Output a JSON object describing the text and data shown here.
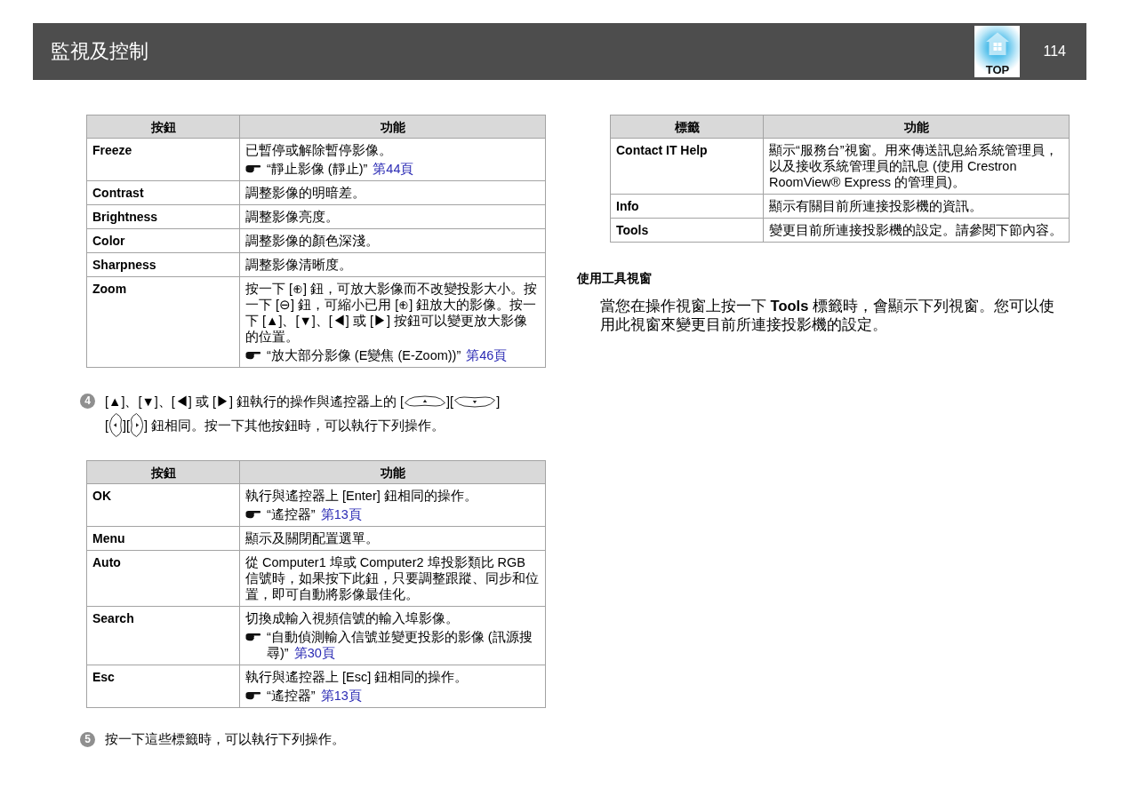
{
  "header": {
    "title": "監視及控制",
    "top_label": "TOP",
    "page_number": "114"
  },
  "left": {
    "table_1": {
      "columns": [
        "按鈕",
        "功能"
      ],
      "rows": [
        {
          "name": "Freeze",
          "description": "已暫停或解除暫停影像。",
          "reference": {
            "text": "“靜止影像 (靜止)”",
            "page": "第44頁"
          }
        },
        {
          "name": "Contrast",
          "description": "調整影像的明暗差。"
        },
        {
          "name": "Brightness",
          "description": "調整影像亮度。"
        },
        {
          "name": "Color",
          "description": "調整影像的顏色深淺。"
        },
        {
          "name": "Sharpness",
          "description": "調整影像清晰度。"
        },
        {
          "name": "Zoom",
          "description": "按一下 [⊕] 鈕，可放大影像而不改變投影大小。按一下 [⊖] 鈕，可縮小已用 [⊕] 鈕放大的影像。按一下 [▲]、[▼]、[◀] 或 [▶] 按鈕可以變更放大影像的位置。",
          "reference": {
            "text": "“放大部分影像 (E變焦 (E-Zoom))”",
            "page": "第46頁"
          }
        }
      ]
    },
    "step_4": {
      "number": "4",
      "lines": [
        [
          "[▲]、[▼]、[◀] 或 [▶] 鈕執行的操作與遙控器上的 [",
          "][",
          "]"
        ],
        [
          "[",
          "][",
          "] 鈕相同。按一下其他按鈕時，可以執行下列操作。"
        ]
      ]
    },
    "table_2": {
      "columns": [
        "按鈕",
        "功能"
      ],
      "rows": [
        {
          "name": "OK",
          "description": "執行與遙控器上 [Enter] 鈕相同的操作。",
          "reference": {
            "text": "“遙控器”",
            "page": "第13頁"
          }
        },
        {
          "name": "Menu",
          "description": "顯示及關閉配置選單。"
        },
        {
          "name": "Auto",
          "description": "從 Computer1 埠或 Computer2 埠投影類比 RGB 信號時，如果按下此鈕，只要調整跟蹤、同步和位置，即可自動將影像最佳化。"
        },
        {
          "name": "Search",
          "description": "切換成輸入視頻信號的輸入埠影像。",
          "reference": {
            "text": "“自動偵測輸入信號並變更投影的影像 (訊源搜尋)”",
            "page": "第30頁"
          }
        },
        {
          "name": "Esc",
          "description": "執行與遙控器上 [Esc] 鈕相同的操作。",
          "reference": {
            "text": "“遙控器”",
            "page": "第13頁"
          }
        }
      ]
    },
    "step_5": {
      "number": "5",
      "text": "按一下這些標籤時，可以執行下列操作。"
    }
  },
  "right": {
    "table": {
      "columns": [
        "標籤",
        "功能"
      ],
      "rows": [
        {
          "name": "Contact IT Help",
          "description": "顯示“服務台”視窗。用來傳送訊息給系統管理員，以及接收系統管理員的訊息 (使用 Crestron RoomView® Express 的管理員)。"
        },
        {
          "name": "Info",
          "description": "顯示有關目前所連接投影機的資訊。"
        },
        {
          "name": "Tools",
          "description": "變更目前所連接投影機的設定。請參閱下節內容。"
        }
      ]
    },
    "section_heading": "使用工具視窗",
    "paragraph": "當您在操作視窗上按一下 **Tools** 標籤時，會顯示下列視窗。您可以使用此視窗來變更目前所連接投影機的設定。"
  }
}
